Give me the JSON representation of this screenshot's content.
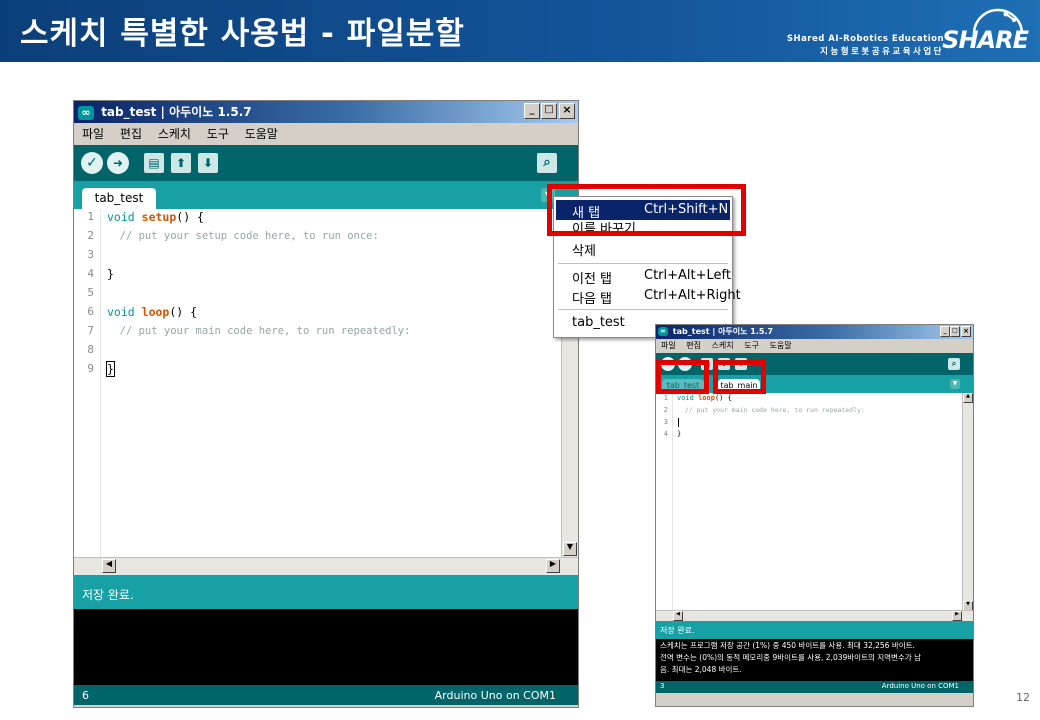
{
  "header": {
    "title": "스케치 특별한 사용법 - 파일분할",
    "brand_en": "SHared AI-Robotics Education",
    "brand_ko": "지능형로봇공유교육사업단",
    "brand_logo": "SHARE"
  },
  "main_window": {
    "title": "tab_test | 아두이노 1.5.7",
    "logo_glyph": "∞",
    "controls": [
      "_",
      "□",
      "×"
    ],
    "menu": [
      "파일",
      "편집",
      "스케치",
      "도구",
      "도움말"
    ],
    "toolbar_icons": [
      "verify-icon",
      "upload-icon",
      "new-icon",
      "open-icon",
      "save-icon",
      "serial-monitor-icon"
    ],
    "toolbar_glyphs": {
      "verify": "✓",
      "upload": "➜",
      "new": "▤",
      "open": "⬆",
      "save": "⬇",
      "monitor": "⌕"
    },
    "tab": "tab_test",
    "tab_arrow": "▼",
    "line_numbers": [
      "1",
      "2",
      "3",
      "4",
      "5",
      "6",
      "7",
      "8",
      "9"
    ],
    "code": {
      "l1_kw": "void",
      "l1_fn": "setup",
      "l1_rest": "() {",
      "l2": "  // put your setup code here, to run once:",
      "l4": "}",
      "l6_kw": "void",
      "l6_fn": "loop",
      "l6_rest": "() {",
      "l7": "  // put your main code here, to run repeatedly:",
      "l9": "}"
    },
    "status": "저장 완료.",
    "footer_left": "6",
    "footer_right": "Arduino Uno on COM1"
  },
  "context_menu": {
    "items": [
      {
        "label": "새 탭",
        "shortcut": "Ctrl+Shift+N",
        "selected": true
      },
      {
        "label": "이름 바꾸기",
        "shortcut": "",
        "selected": false
      },
      {
        "label": "삭제",
        "shortcut": "",
        "selected": false
      },
      {
        "label": "이전 탭",
        "shortcut": "Ctrl+Alt+Left",
        "selected": false
      },
      {
        "label": "다음 탭",
        "shortcut": "Ctrl+Alt+Right",
        "selected": false
      },
      {
        "label": "tab_test",
        "shortcut": "",
        "selected": false
      }
    ]
  },
  "small_window": {
    "title": "tab_test | 아두이노 1.5.7",
    "menu": [
      "파일",
      "편집",
      "스케치",
      "도구",
      "도움말"
    ],
    "tabs": [
      "tab_test",
      "tab_main"
    ],
    "line_numbers": [
      "1",
      "2",
      "3",
      "4"
    ],
    "code": {
      "l1_kw": "void",
      "l1_fn": "loop",
      "l1_rest": "() {",
      "l2": "  // put your main code here, to run repeatedly:",
      "l4": "}"
    },
    "status": "저장 완료.",
    "console": [
      "스케치는 프로그램 저장 공간 (1%) 중 450 바이트를 사용. 최대 32,256 바이트.",
      "전역 변수는 (0%)의 동적 메모리중 9바이트를 사용, 2,039바이트의 지역변수가 남",
      "음. 최대는 2,048 바이트."
    ],
    "footer_left": "3",
    "footer_right": "Arduino Uno on COM1"
  },
  "page_number": "12",
  "colors": {
    "header_blue": "#13549a",
    "arduino_teal": "#00979c",
    "toolbar_dark": "#006468",
    "tabbar": "#17a1a5",
    "highlight_red": "#e00000",
    "menu_select": "#0a246a"
  }
}
